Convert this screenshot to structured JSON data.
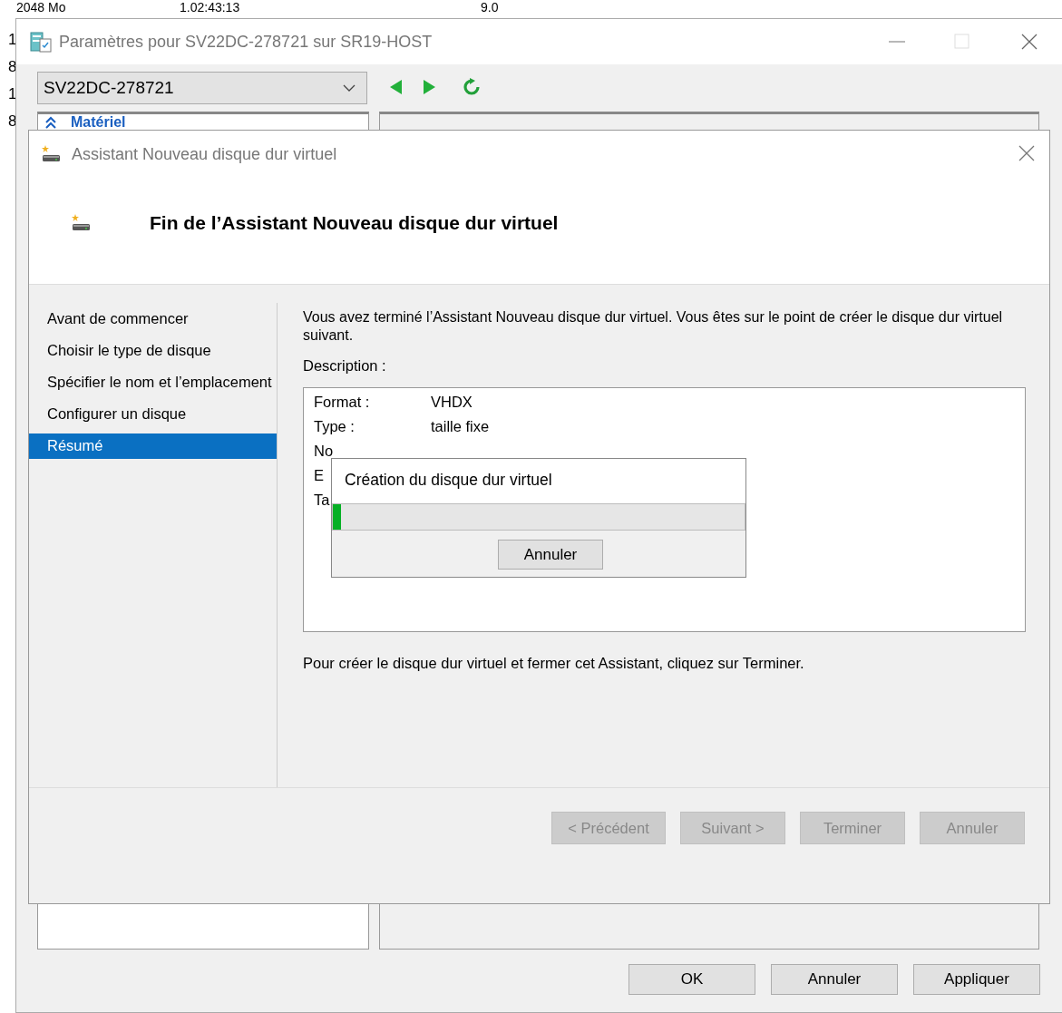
{
  "background_list": {
    "row_cells": [
      "2048 Mo",
      "1.02:43:13",
      "9.0"
    ],
    "left_digits": [
      "1",
      "8",
      "1",
      "8"
    ]
  },
  "settings_window": {
    "title": "Paramètres pour SV22DC-278721 sur SR19-HOST",
    "vm_select": {
      "value": "SV22DC-278721"
    },
    "tree_heading": "Matériel",
    "buttons": [
      "OK",
      "Annuler",
      "Appliquer"
    ]
  },
  "wizard": {
    "title": "Assistant Nouveau disque dur virtuel",
    "heading": "Fin de l’Assistant Nouveau disque dur virtuel",
    "steps": [
      {
        "label": "Avant de commencer",
        "selected": false
      },
      {
        "label": "Choisir le type de disque",
        "selected": false
      },
      {
        "label": "Spécifier le nom et l’emplacement",
        "selected": false
      },
      {
        "label": "Configurer un disque",
        "selected": false
      },
      {
        "label": "Résumé",
        "selected": true
      }
    ],
    "intro": "Vous avez terminé l’Assistant Nouveau disque dur virtuel. Vous êtes sur le point de créer le disque dur virtuel suivant.",
    "description_label": "Description :",
    "description_rows": [
      {
        "label": "Format :",
        "value": "VHDX"
      },
      {
        "label": "Type :",
        "value": "taille fixe"
      },
      {
        "label": "No"
      },
      {
        "label": "E"
      },
      {
        "label": "Ta"
      }
    ],
    "footer_text": "Pour créer le disque dur virtuel et fermer cet Assistant, cliquez sur Terminer.",
    "buttons": [
      {
        "label": "< Précédent",
        "disabled": true
      },
      {
        "label": "Suivant >",
        "disabled": true
      },
      {
        "label": "Terminer",
        "disabled": true
      },
      {
        "label": "Annuler",
        "disabled": true
      }
    ]
  },
  "progress_dialog": {
    "title": "Création du disque dur virtuel",
    "level": 0.02,
    "button": "Annuler"
  }
}
